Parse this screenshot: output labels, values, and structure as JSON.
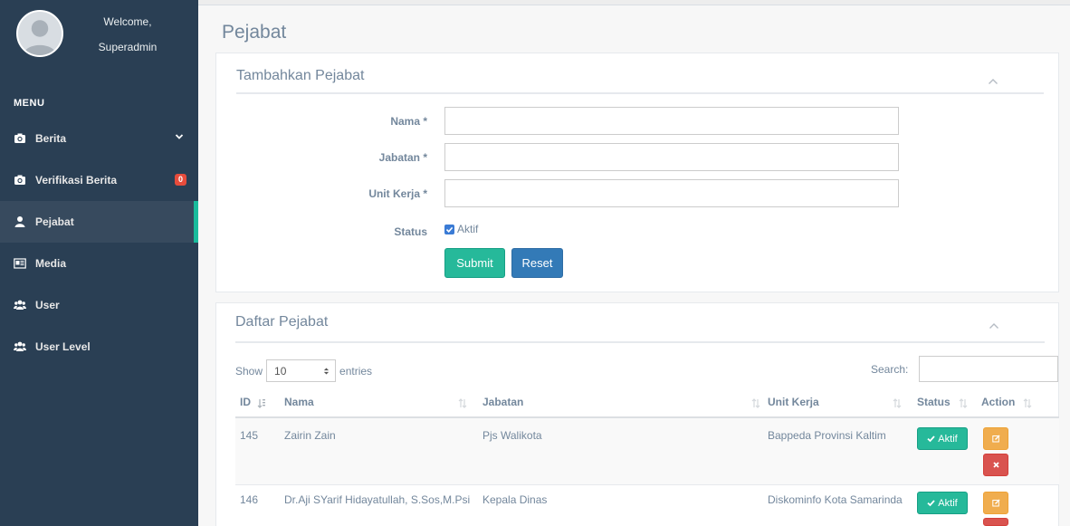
{
  "sidebar": {
    "welcome": "Welcome,",
    "username": "Superadmin",
    "menu_title": "MENU",
    "items": [
      {
        "label": "Berita",
        "icon": "camera-icon"
      },
      {
        "label": "Verifikasi Berita",
        "icon": "camera-icon",
        "badge": "0"
      },
      {
        "label": "Pejabat",
        "icon": "user-icon",
        "active": true
      },
      {
        "label": "Media",
        "icon": "id-card-icon"
      },
      {
        "label": "User",
        "icon": "users-icon"
      },
      {
        "label": "User Level",
        "icon": "users-icon"
      }
    ]
  },
  "page": {
    "title": "Pejabat"
  },
  "form_panel": {
    "title": "Tambahkan Pejabat",
    "fields": [
      {
        "label": "Nama *",
        "value": ""
      },
      {
        "label": "Jabatan *",
        "value": ""
      },
      {
        "label": "Unit Kerja *",
        "value": ""
      }
    ],
    "status_label": "Status",
    "status_checkbox": "Aktif",
    "submit_label": "Submit",
    "reset_label": "Reset"
  },
  "list_panel": {
    "title": "Daftar Pejabat",
    "show_label": "Show",
    "entries_value": "10",
    "entries_label": "entries",
    "search_label": "Search:",
    "search_value": "",
    "columns": [
      "ID",
      "Nama",
      "Jabatan",
      "Unit Kerja",
      "Status",
      "Action"
    ],
    "rows": [
      {
        "id": "145",
        "nama": "Zairin Zain",
        "jabatan": "Pjs Walikota",
        "unit_kerja": "Bappeda Provinsi Kaltim",
        "status": "Aktif"
      },
      {
        "id": "146",
        "nama": "Dr.Aji SYarif Hidayatullah, S.Sos,M.Psi",
        "jabatan": "Kepala Dinas",
        "unit_kerja": "Diskominfo Kota Samarinda",
        "status": "Aktif"
      }
    ]
  },
  "colors": {
    "sidebar_bg": "#2a3f54",
    "accent_green": "#26b99a",
    "primary_blue": "#337ab7",
    "badge_red": "#e74c3c",
    "edit_orange": "#f0ad4e",
    "delete_red": "#d9534f"
  }
}
